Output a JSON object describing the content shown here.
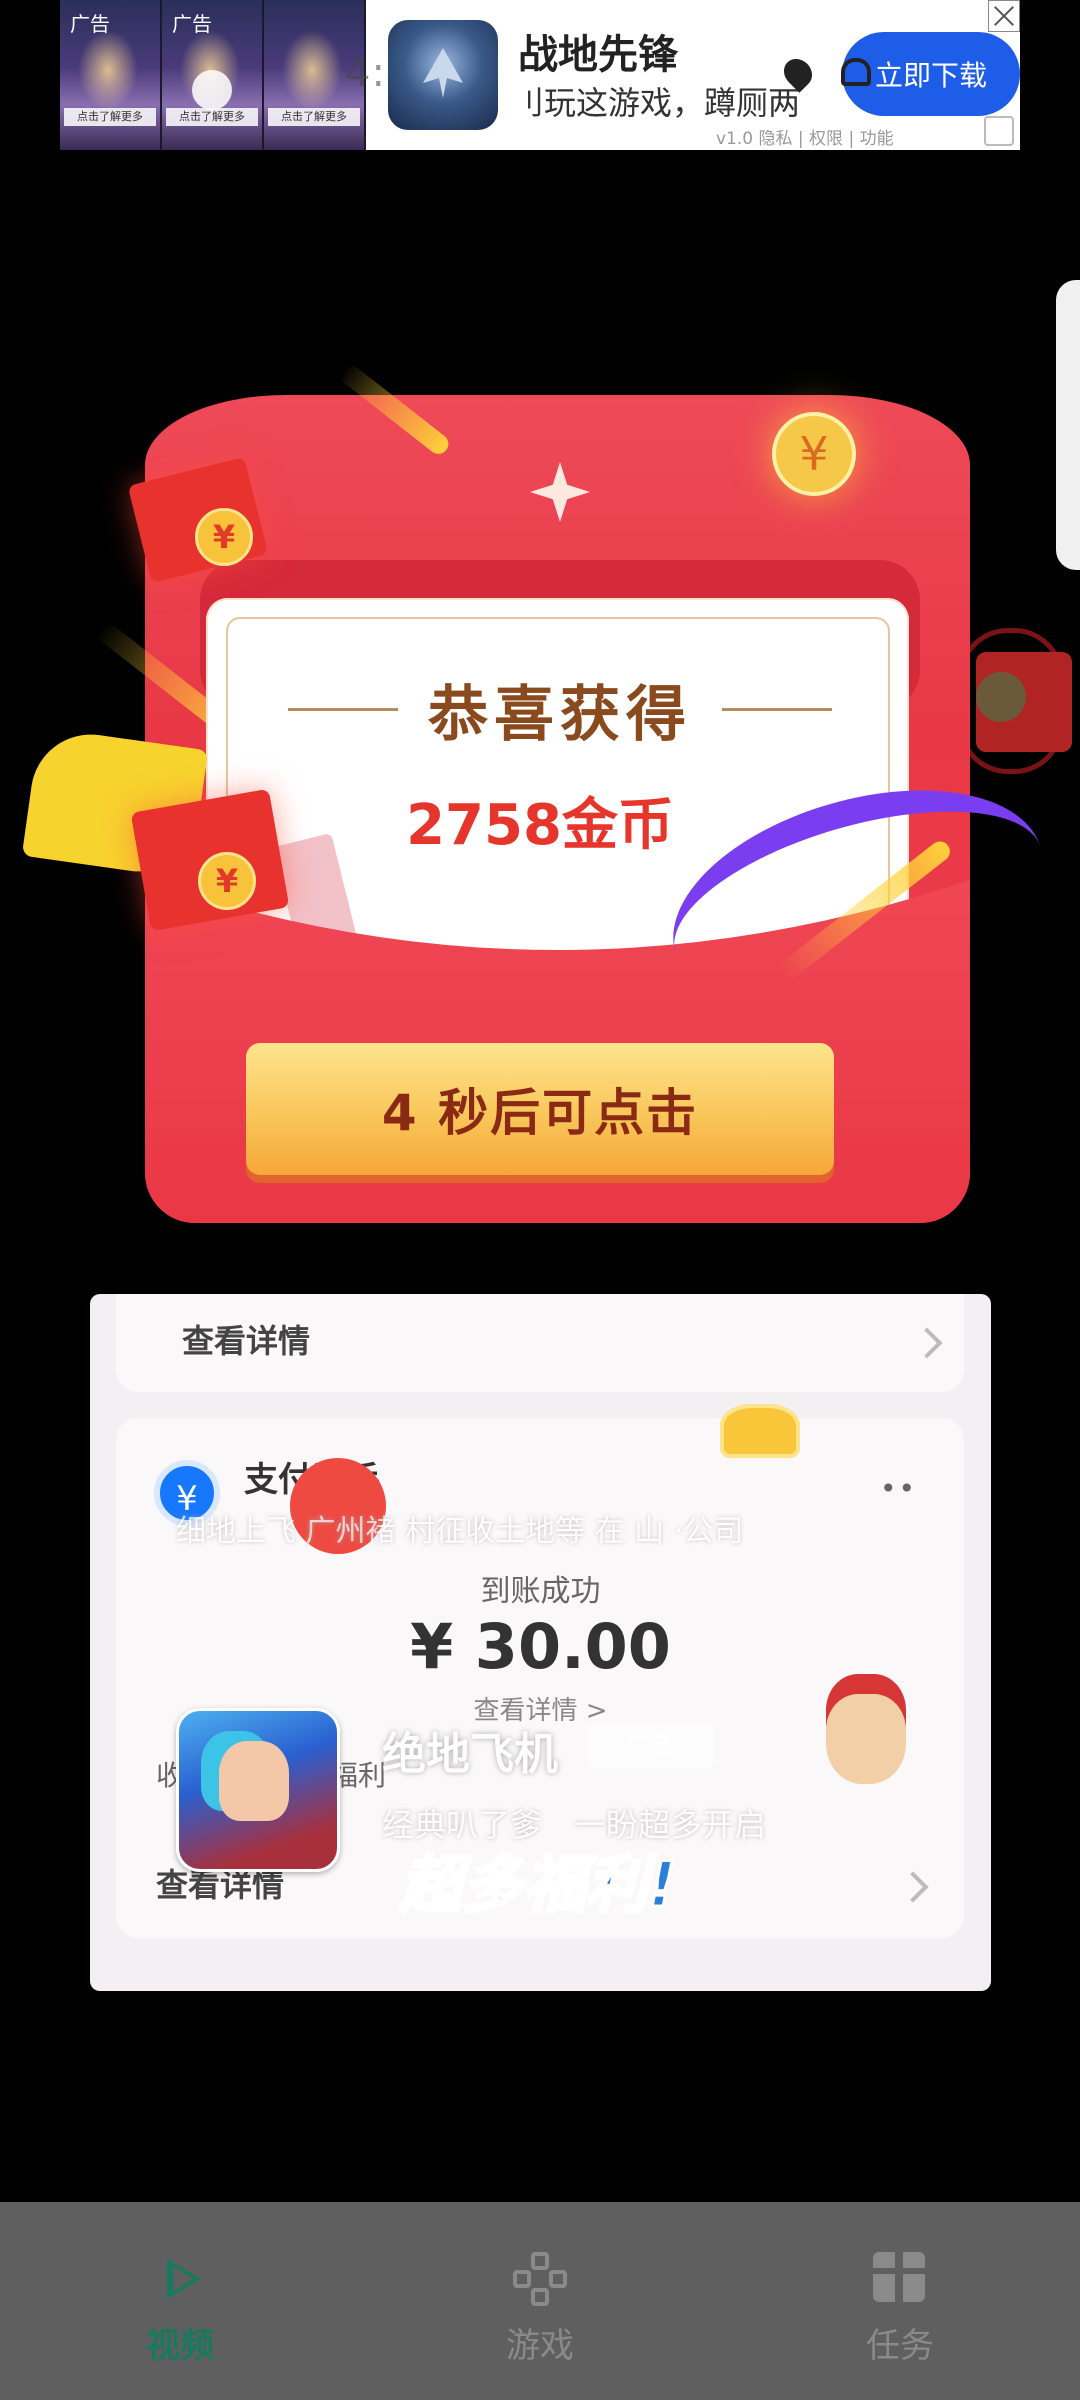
{
  "top_ad": {
    "thumb_tags": [
      "广告",
      "广告"
    ],
    "thumb_caption": "点击了解更多",
    "clock": "4:40",
    "title": "战地先锋",
    "description": "刂玩这游戏，蹲厕两",
    "meta": "v1.0  隐私 | 权限 | 功能",
    "download_label": "立即下载"
  },
  "reward_card": {
    "title": "恭喜获得",
    "amount": "2758金币",
    "countdown_label": "4 秒后可点击",
    "coin_symbol": "¥"
  },
  "video_ad": {
    "detail_label_top": "查看详情",
    "pay_title": "支付助手",
    "marquee": "细地上飞 广州褚 村征收土地等 在 山 ·公司",
    "success_text": "到账成功",
    "money": "¥ 30.00",
    "money_detail": "查看详情 >",
    "bonus_prefix": "收",
    "bonus_text": "活福利",
    "game_title": "绝地飞机",
    "ad_tag": "广告",
    "slogan": "经典叭了爹　一盼超多开启",
    "detail_label_bottom": "查看详情",
    "welfare_banner": "超多福利!"
  },
  "bottom_nav": {
    "items": [
      {
        "label": "视频",
        "icon": "play-icon",
        "active": true
      },
      {
        "label": "游戏",
        "icon": "gamepad-icon",
        "active": false
      },
      {
        "label": "任务",
        "icon": "gift-icon",
        "active": false
      }
    ]
  },
  "colors": {
    "envelope_red": "#e83846",
    "button_gold": "#f9c65a",
    "nav_active": "#177a5f",
    "amount_red": "#e6352b"
  }
}
